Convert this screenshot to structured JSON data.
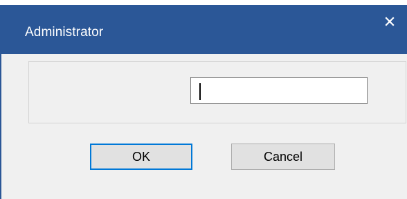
{
  "window": {
    "title": "Administrator",
    "close_icon": "close-icon",
    "titlebar_color": "#2b5797"
  },
  "form": {
    "input_value": "",
    "ok_label": "OK",
    "cancel_label": "Cancel",
    "focus_accent": "#0078d7"
  }
}
